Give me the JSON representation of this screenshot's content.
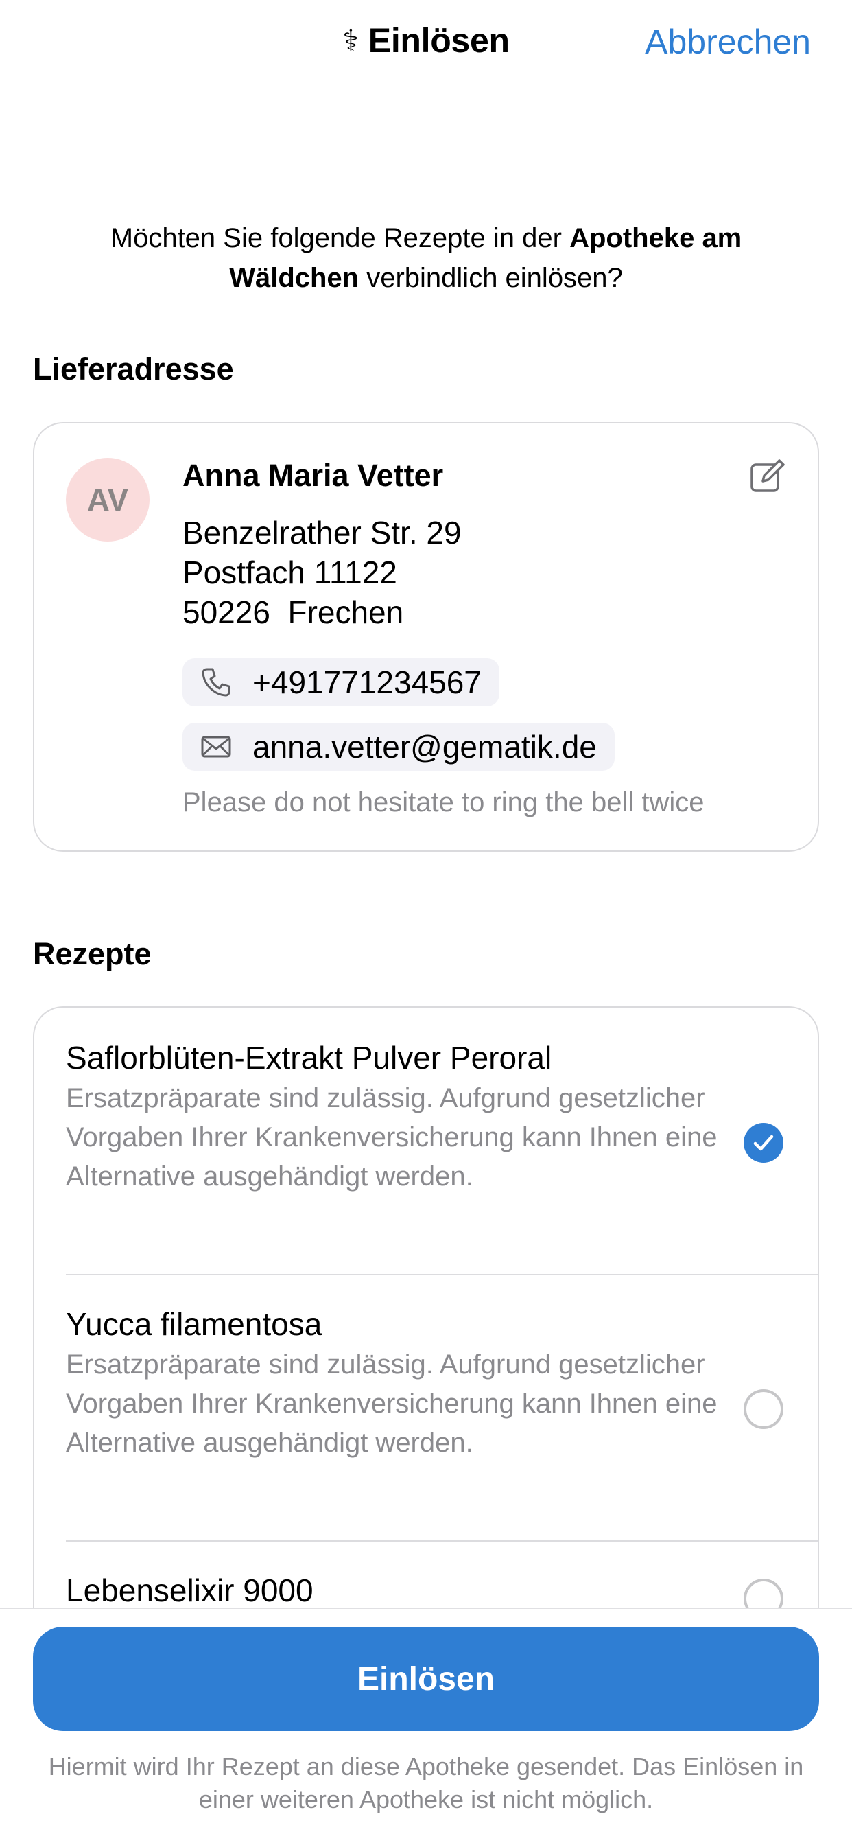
{
  "nav": {
    "title_icon": "caduceus-icon",
    "title_icon_glyph": "⚕",
    "title": "Einlösen",
    "cancel": "Abbrechen"
  },
  "question": {
    "prefix": "Möchten Sie folgende Rezepte in der ",
    "pharmacy": "Apotheke am Wäldchen",
    "suffix": " verbindlich einlösen?"
  },
  "address": {
    "section_title": "Lieferadresse",
    "initials": "AV",
    "name": "Anna Maria Vetter",
    "lines": [
      "Benzelrather Str. 29",
      "Postfach 11122",
      "50226  Frechen"
    ],
    "phone": "+491771234567",
    "email": "anna.vetter@gematik.de",
    "note": "Please do not hesitate to ring the bell twice",
    "icons": {
      "edit": "edit-icon",
      "phone": "phone-icon",
      "email": "envelope-icon"
    }
  },
  "prescriptions": {
    "section_title": "Rezepte",
    "items": [
      {
        "name": "Saflorblüten-Extrakt Pulver Peroral",
        "description": "Ersatzpräparate sind zulässig. Aufgrund gesetzlicher Vorgaben Ihrer Krankenversicherung kann Ihnen eine Alternative ausgehändigt werden.",
        "selected": true
      },
      {
        "name": "Yucca filamentosa",
        "description": "Ersatzpräparate sind zulässig. Aufgrund gesetzlicher Vorgaben Ihrer Krankenversicherung kann Ihnen eine Alternative ausgehändigt werden.",
        "selected": false
      },
      {
        "name": "Lebenselixir 9000",
        "description": "",
        "selected": false
      }
    ]
  },
  "footer": {
    "button": "Einlösen",
    "note": "Hiermit wird Ihr Rezept an diese Apotheke gesendet. Das Einlösen in einer weiteren Apotheke ist nicht möglich."
  },
  "colors": {
    "accent": "#2f7ed3",
    "secondary_text": "#8a8a8e",
    "avatar_bg": "#fadcdc"
  }
}
